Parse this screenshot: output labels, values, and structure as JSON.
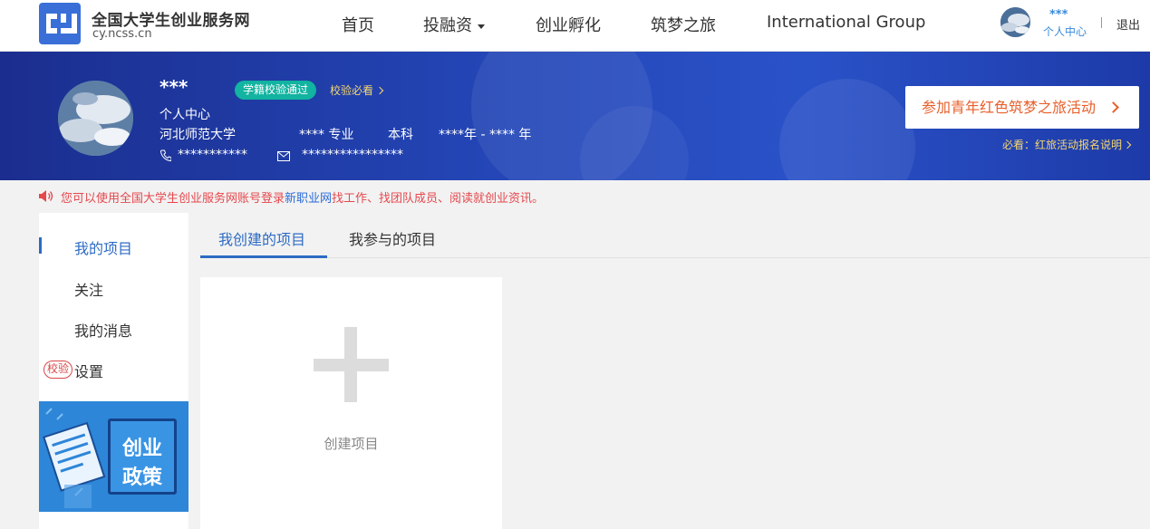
{
  "header": {
    "site_name": "全国大学生创业服务网",
    "site_url": "cy.ncss.cn",
    "logo_icon": "cy-logo-icon",
    "nav": [
      {
        "label": "首页"
      },
      {
        "label": "投融资"
      },
      {
        "label": "创业孵化"
      },
      {
        "label": "筑梦之旅"
      },
      {
        "label": "International Group"
      }
    ],
    "user_name": "***",
    "user_center": "个人中心",
    "logout": "退出"
  },
  "profile": {
    "name": "***",
    "badge": "学籍校验通过",
    "verify_link": "校验必看",
    "center_label": "个人中心",
    "school": "河北师范大学",
    "major": "**** 专业",
    "degree": "本科",
    "years": "****年 - **** 年",
    "phone": "***********",
    "email": "****************",
    "join_button": "参加青年红色筑梦之旅活动",
    "must_read": "必看：红旅活动报名说明"
  },
  "notice": {
    "before": "您可以使用全国大学生创业服务网账号登录",
    "link": "新职业网",
    "after": "找工作、找团队成员、阅读就创业资讯。"
  },
  "sidebar": {
    "items": [
      {
        "label": "我的项目"
      },
      {
        "label": "关注"
      },
      {
        "label": "我的消息"
      },
      {
        "label": "设置"
      }
    ],
    "verify_tag": "校验",
    "policy_line1": "创业",
    "policy_line2": "政策"
  },
  "tabs": [
    {
      "label": "我创建的项目"
    },
    {
      "label": "我参与的项目"
    }
  ],
  "create_card": {
    "label": "创建项目"
  },
  "colors": {
    "primary": "#2d6bc4",
    "banner": "#2447b8",
    "accent_orange": "#e8602c",
    "badge_teal": "#12b3a0",
    "notice_red": "#e5484d"
  }
}
